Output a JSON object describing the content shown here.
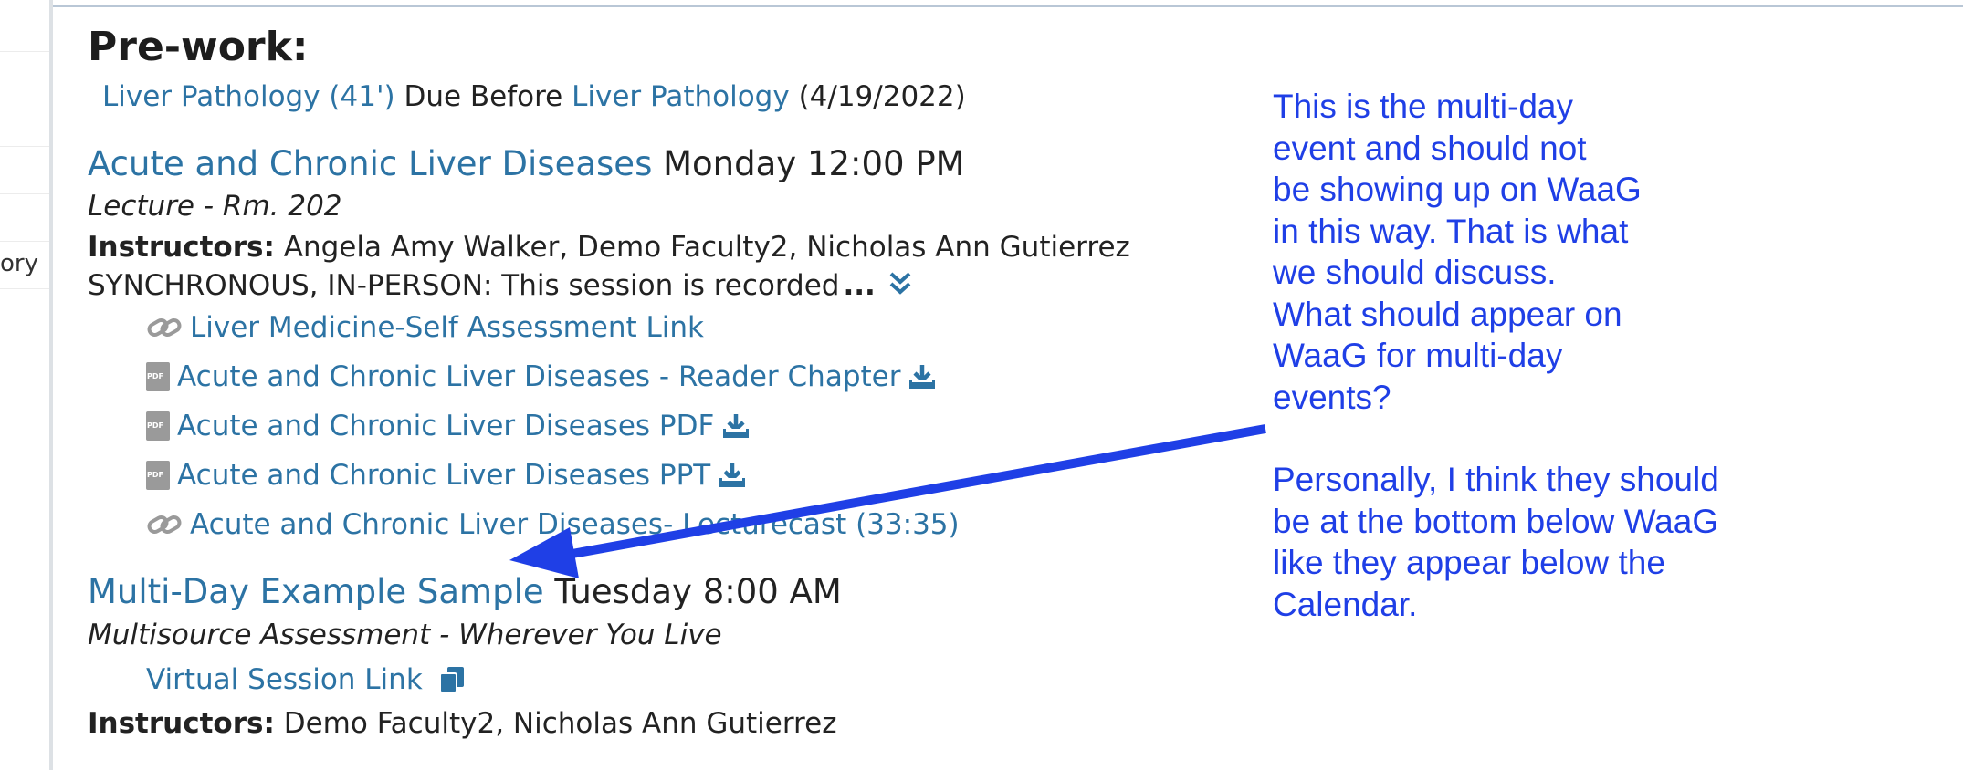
{
  "sidebar": {
    "fragment_text": "ory"
  },
  "prework": {
    "heading": "Pre-work:",
    "item_link": "Liver Pathology (41')",
    "due_before": "Due Before",
    "due_link": "Liver Pathology",
    "due_date": "(4/19/2022)"
  },
  "events": [
    {
      "title": "Acute and Chronic Liver Diseases",
      "time": "Monday 12:00 PM",
      "type": "Lecture - Rm. 202",
      "instructors_label": "Instructors:",
      "instructors": "Angela Amy Walker, Demo Faculty2, Nicholas Ann Gutierrez",
      "description": "SYNCHRONOUS, IN-PERSON:  This session is recorded",
      "ellipsis": "...",
      "resources": [
        {
          "icon": "link-icon",
          "label": "Liver Medicine-Self Assessment Link"
        },
        {
          "icon": "pdf-icon",
          "label": "Acute and Chronic Liver Diseases - Reader Chapter",
          "download": true
        },
        {
          "icon": "pdf-icon",
          "label": "Acute and Chronic Liver Diseases PDF",
          "download": true
        },
        {
          "icon": "pdf-icon",
          "label": "Acute and Chronic Liver Diseases PPT",
          "download": true
        },
        {
          "icon": "link-icon",
          "label": "Acute and Chronic Liver Diseases- Lecturecast (33:35)"
        }
      ]
    },
    {
      "title": "Multi-Day Example Sample",
      "time": "Tuesday 8:00 AM",
      "type": "Multisource Assessment - Wherever You Live",
      "virtual_link": "Virtual Session Link",
      "instructors_label": "Instructors:",
      "instructors": "Demo Faculty2, Nicholas Ann Gutierrez"
    }
  ],
  "annotation": {
    "paragraph1": "This is the multi-day\nevent and should not\nbe showing up on WaaG\nin this way. That is what\nwe should discuss.\nWhat should appear on\nWaaG for multi-day\nevents?",
    "paragraph2": "Personally, I think they should\nbe at the bottom below WaaG\nlike they appear below the\nCalendar.",
    "color": "#1f3fe6"
  },
  "colors": {
    "link": "#2c73a4",
    "text": "#222222",
    "annotation": "#1f3fe6"
  }
}
